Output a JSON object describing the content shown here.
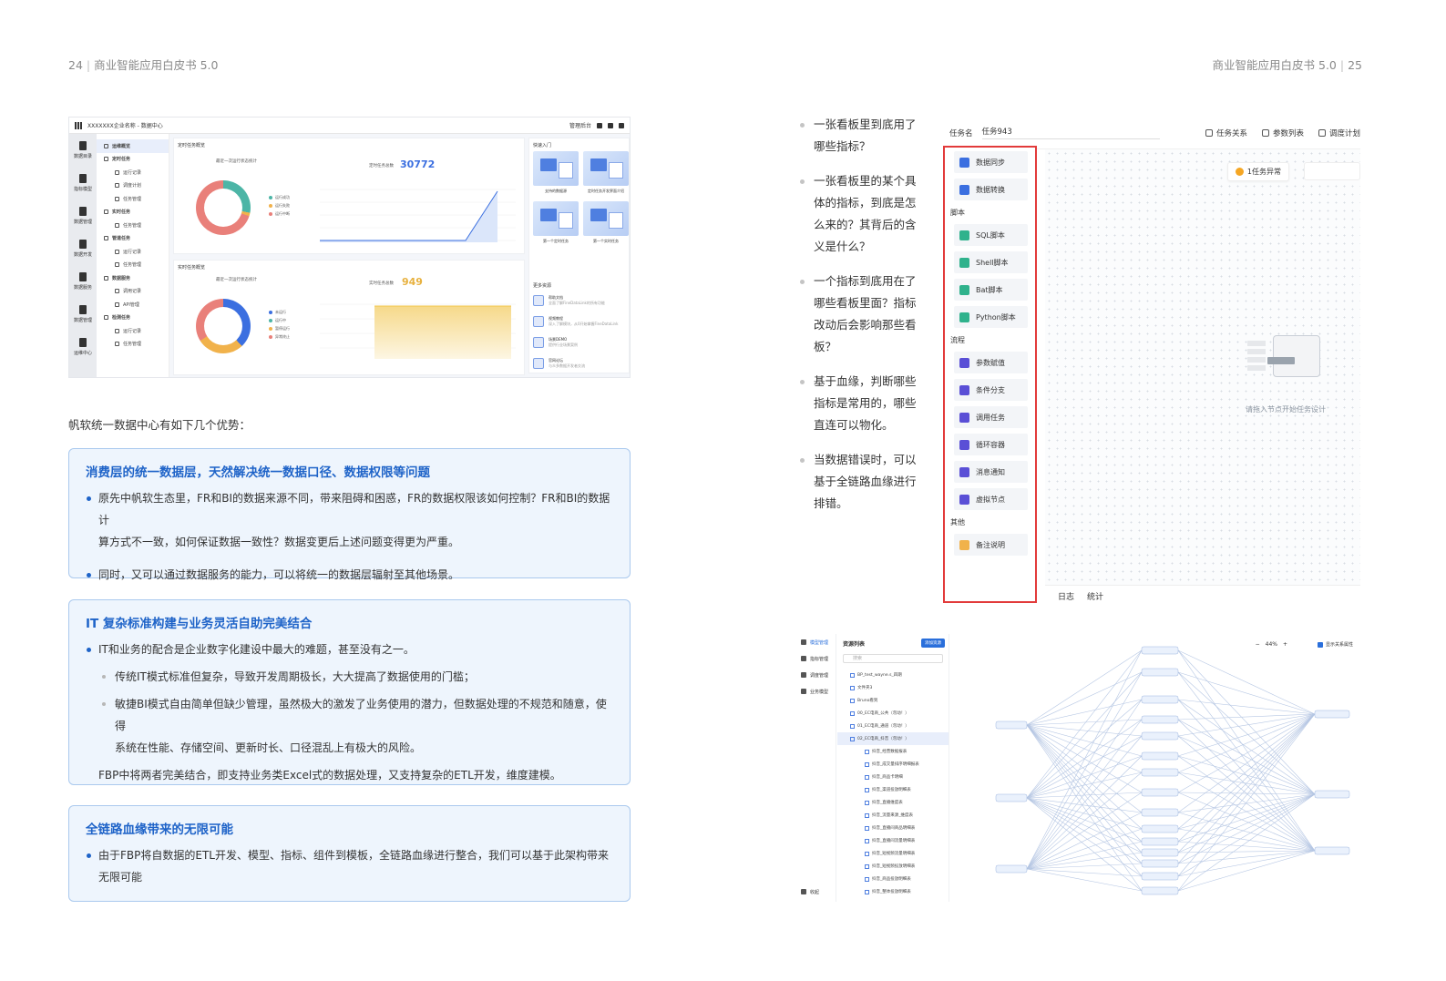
{
  "header": {
    "left_page_number": "24",
    "left_title": "商业智能应用白皮书 5.0",
    "right_title": "商业智能应用白皮书 5.0",
    "right_page_number": "25"
  },
  "dashboard": {
    "breadcrumb": "XXXXXXX企业名称 - 数据中心",
    "top_right": "管理后台",
    "rail": [
      "数据目录",
      "指标模型",
      "数据管理",
      "数据开发",
      "数据服务",
      "数据管理",
      "运维中心"
    ],
    "menu": [
      {
        "label": "运维概览",
        "level": 1,
        "active": true
      },
      {
        "label": "定时任务",
        "level": 1
      },
      {
        "label": "运行记录",
        "level": 2
      },
      {
        "label": "调度计划",
        "level": 2
      },
      {
        "label": "任务管理",
        "level": 2
      },
      {
        "label": "实时任务",
        "level": 1
      },
      {
        "label": "任务管理",
        "level": 2
      },
      {
        "label": "管道任务",
        "level": 1
      },
      {
        "label": "运行记录",
        "level": 2
      },
      {
        "label": "任务管理",
        "level": 2
      },
      {
        "label": "数据服务",
        "level": 1
      },
      {
        "label": "调用记录",
        "level": 2
      },
      {
        "label": "API管理",
        "level": 2
      },
      {
        "label": "检测任务",
        "level": 1
      },
      {
        "label": "运行记录",
        "level": 2
      },
      {
        "label": "任务管理",
        "level": 2
      }
    ],
    "panel1": {
      "title": "定时任务概览",
      "donut_title": "最近一次运行状态统计",
      "legend": [
        "运行成功",
        "运行失败",
        "运行中断"
      ],
      "total_label": "定时任务总数",
      "total_value": "30772"
    },
    "panel2": {
      "title": "实时任务概览",
      "donut_title": "最近一次运行状态统计",
      "legend": [
        "未运行",
        "运行中",
        "暂停运行",
        "异常终止"
      ],
      "total_label": "实时任务总数",
      "total_value": "949"
    },
    "quick_title": "快速入门",
    "quick_cards": [
      "支持的数据源",
      "定时任务开发界面介绍",
      "第一个定时任务",
      "第一个实时任务"
    ],
    "more_title": "更多资源",
    "more_items": [
      {
        "title": "帮助文档",
        "desc": "全面了解FineDataLink的所有功能"
      },
      {
        "title": "视频教程",
        "desc": "深入了解模块，从0开始掌握FineDataLink"
      },
      {
        "title": "场景DEMO",
        "desc": "提供行业场景案例"
      },
      {
        "title": "官网论坛",
        "desc": "与众多数据开发者交流"
      },
      {
        "title": "问题反馈",
        "desc": "产品问题、需求反馈入口"
      }
    ],
    "colors": {
      "success": "#4cb5a6",
      "fail": "#e9807a",
      "interrupt": "#f1b24b",
      "blue": "#3b6fe0",
      "yellow": "#f2c74e"
    }
  },
  "intro": "帆软统一数据中心有如下几个优势：",
  "boxes": [
    {
      "title": "消费层的统一数据层，天然解决统一数据口径、数据权限等问题",
      "bullets": [
        "原先中帆软生态里，FR和BI的数据来源不同，带来阻碍和困惑，FR的数据权限该如何控制？FR和BI的数据计",
        "算方式不一致，如何保证数据一致性？数据变更后上述问题变得更为严重。",
        "同时，又可以通过数据服务的能力，可以将统一的数据层辐射至其他场景。"
      ]
    },
    {
      "title": "IT 复杂标准构建与业务灵活自助完美结合",
      "bullets": [
        "IT和业务的配合是企业数字化建设中最大的难题，甚至没有之一。",
        "传统IT模式标准但复杂，导致开发周期极长，大大提高了数据使用的门槛；",
        "敏捷BI模式自由简单但缺少管理，虽然极大的激发了业务使用的潜力，但数据处理的不规范和随意，使得",
        "系统在性能、存储空间、更新时长、口径混乱上有极大的风险。",
        "FBP中将两者完美结合，即支持业务类Excel式的数据处理，又支持复杂的ETL开发，维度建模。"
      ]
    },
    {
      "title": "全链路血缘带来的无限可能",
      "bullets": [
        "由于FBP将自数据的ETL开发、模型、指标、组件到模板，全链路血缘进行整合，我们可以基于此架构带来",
        "无限可能"
      ]
    }
  ],
  "questions": [
    [
      "一张看板里到底用了",
      "哪些指标？"
    ],
    [
      "一张看板里的某个具",
      "体的指标，到底是怎",
      "么来的？其背后的含",
      "义是什么？"
    ],
    [
      "一个指标到底用在了",
      "哪些看板里面？指标",
      "改动后会影响那些看",
      "板？"
    ],
    [
      "基于血缘，判断哪些",
      "指标是常用的，哪些",
      "直连可以物化。"
    ],
    [
      "当数据错误时，可以",
      "基于全链路血缘进行",
      "排错。"
    ]
  ],
  "task_designer": {
    "name_label": "任务名",
    "name_value": "任务943",
    "tools": [
      "任务关系",
      "参数列表",
      "调度计划"
    ],
    "palette": [
      {
        "type": "item",
        "label": "数据同步",
        "color": "#3b6fe0"
      },
      {
        "type": "item",
        "label": "数据转换",
        "color": "#3b6fe0"
      },
      {
        "type": "cat",
        "label": "脚本"
      },
      {
        "type": "item",
        "label": "SQL脚本",
        "color": "#2fb28c"
      },
      {
        "type": "item",
        "label": "Shell脚本",
        "color": "#2fb28c"
      },
      {
        "type": "item",
        "label": "Bat脚本",
        "color": "#2fb28c"
      },
      {
        "type": "item",
        "label": "Python脚本",
        "color": "#2fb28c"
      },
      {
        "type": "cat",
        "label": "流程"
      },
      {
        "type": "item",
        "label": "参数赋值",
        "color": "#5a4fd6"
      },
      {
        "type": "item",
        "label": "条件分支",
        "color": "#5a4fd6"
      },
      {
        "type": "item",
        "label": "调用任务",
        "color": "#5a4fd6"
      },
      {
        "type": "item",
        "label": "循环容器",
        "color": "#5a4fd6"
      },
      {
        "type": "item",
        "label": "消息通知",
        "color": "#5a4fd6"
      },
      {
        "type": "item",
        "label": "虚拟节点",
        "color": "#5a4fd6"
      },
      {
        "type": "cat",
        "label": "其他"
      },
      {
        "type": "item",
        "label": "备注说明",
        "color": "#f1b24b"
      }
    ],
    "warning": "1任务异常",
    "empty_hint": "请拖入节点开始任务设计",
    "bottom_tabs": [
      "日志",
      "统计"
    ],
    "highlight_color": "#e23b3b"
  },
  "lineage": {
    "rail": [
      "模型管理",
      "指标管理",
      "调度管理",
      "业务模型"
    ],
    "rail_footer": "收起",
    "tree_title": "资源列表",
    "tree_button": "添加资源",
    "search_placeholder": "搜索",
    "tree_rows": [
      {
        "label": "BP_test_wayne.s_四期",
        "level": 0
      },
      {
        "label": "文件夹3",
        "level": 0
      },
      {
        "label": "Bruno看到",
        "level": 0
      },
      {
        "label": "00_EC电商_公共（勿动！）",
        "level": 0
      },
      {
        "label": "01_EC电商_通道（勿动！）",
        "level": 0
      },
      {
        "label": "02_EC电商_抖音（勿动！）",
        "level": 0,
        "selected": true
      },
      {
        "label": "抖音_经营数据报表",
        "level": 1
      },
      {
        "label": "抖音_成交量排序明细报表",
        "level": 1
      },
      {
        "label": "抖音_商品卡明细",
        "level": 1
      },
      {
        "label": "抖音_渠道投放明细表",
        "level": 1
      },
      {
        "label": "抖音_直播维度表",
        "level": 1
      },
      {
        "label": "抖音_流量来源_维度表",
        "level": 1
      },
      {
        "label": "抖音_直播间商品明细表",
        "level": 1
      },
      {
        "label": "抖音_直播间流量明细表",
        "level": 1
      },
      {
        "label": "抖音_短视频流量明细表",
        "level": 1
      },
      {
        "label": "抖音_短视频投放明细表",
        "level": 1
      },
      {
        "label": "抖音_商品投放明细表",
        "level": 1
      },
      {
        "label": "抖音_整体投放明细表",
        "level": 1
      }
    ],
    "zoom": "44%",
    "zoom_minus": "−",
    "zoom_plus": "+",
    "option": "显示关系属性"
  }
}
